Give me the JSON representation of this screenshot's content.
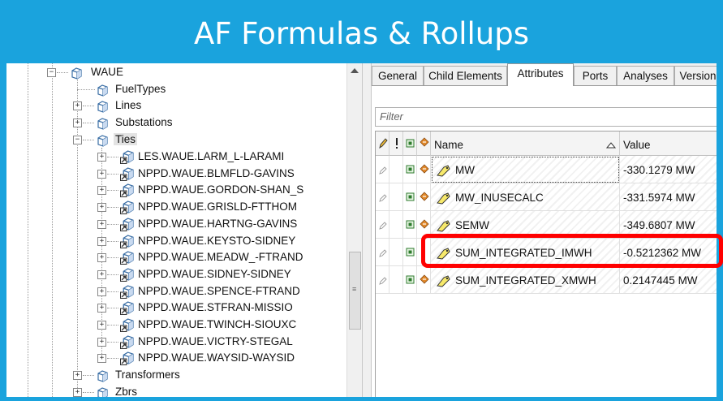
{
  "banner": {
    "title": "AF Formulas & Rollups"
  },
  "tree": {
    "root": "WAUE",
    "children": [
      {
        "label": "FuelTypes",
        "expander": ""
      },
      {
        "label": "Lines",
        "expander": "+"
      },
      {
        "label": "Substations",
        "expander": "+"
      },
      {
        "label": "Ties",
        "expander": "-"
      },
      {
        "label": "Transformers",
        "expander": "+"
      },
      {
        "label": "Zbrs",
        "expander": "+"
      }
    ],
    "ties": [
      "LES.WAUE.LARM_L-LARAMI",
      "NPPD.WAUE.BLMFLD-GAVINS",
      "NPPD.WAUE.GORDON-SHAN_S",
      "NPPD.WAUE.GRISLD-FTTHOM",
      "NPPD.WAUE.HARTNG-GAVINS",
      "NPPD.WAUE.KEYSTO-SIDNEY",
      "NPPD.WAUE.MEADW_-FTRAND",
      "NPPD.WAUE.SIDNEY-SIDNEY",
      "NPPD.WAUE.SPENCE-FTRAND",
      "NPPD.WAUE.STFRAN-MISSIO",
      "NPPD.WAUE.TWINCH-SIOUXC",
      "NPPD.WAUE.VICTRY-STEGAL",
      "NPPD.WAUE.WAYSID-WAYSID"
    ]
  },
  "tabs": [
    {
      "label": "General"
    },
    {
      "label": "Child Elements"
    },
    {
      "label": "Attributes",
      "active": true
    },
    {
      "label": "Ports"
    },
    {
      "label": "Analyses"
    },
    {
      "label": "Version"
    }
  ],
  "filter": {
    "placeholder": "Filter"
  },
  "grid": {
    "columns": {
      "name": "Name",
      "value": "Value"
    },
    "rows": [
      {
        "name": "MW",
        "value": "-330.1279 MW"
      },
      {
        "name": "MW_INUSECALC",
        "value": "-331.5974 MW"
      },
      {
        "name": "SEMW",
        "value": "-349.6807 MW"
      },
      {
        "name": "SUM_INTEGRATED_IMWH",
        "value": "-0.5212362 MW"
      },
      {
        "name": "SUM_INTEGRATED_XMWH",
        "value": "0.2147445 MW"
      }
    ]
  },
  "colors": {
    "banner": "#1aa3dd",
    "highlight": "#ff0000"
  }
}
